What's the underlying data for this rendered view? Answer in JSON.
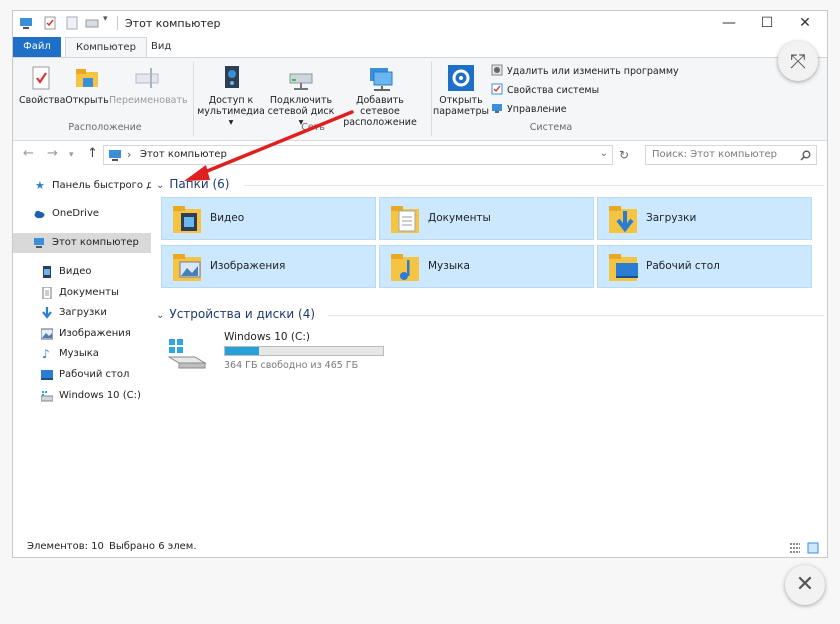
{
  "window": {
    "title": "Этот компьютер",
    "minimize_glyph": "—",
    "maximize_glyph": "☐",
    "close_glyph": "✕"
  },
  "ribbon_tabs": [
    {
      "label": "Файл"
    },
    {
      "label": "Компьютер"
    },
    {
      "label": "Вид"
    }
  ],
  "ribbon": {
    "groups": {
      "location": "Расположение",
      "network": "Сеть",
      "system": "Система"
    },
    "buttons": {
      "properties": "Свойства",
      "open": "Открыть",
      "rename": "Переименовать",
      "media_line1": "Доступ к",
      "media_line2": "мультимедиа ▾",
      "map_drive_line1": "Подключить",
      "map_drive_line2": "сетевой диск ▾",
      "add_location_line1": "Добавить сетевое",
      "add_location_line2": "расположение",
      "open_settings_line1": "Открыть",
      "open_settings_line2": "параметры",
      "uninstall": "Удалить или изменить программу",
      "system_props": "Свойства системы",
      "manage": "Управление"
    }
  },
  "address_bar": {
    "path": "Этот компьютер",
    "separator": "›",
    "search_placeholder": "Поиск: Этот компьютер"
  },
  "nav_pane": [
    {
      "label": "Панель быстрого дс",
      "icon": "star-icon"
    },
    {
      "label": "OneDrive",
      "icon": "cloud-icon"
    },
    {
      "label": "Этот компьютер",
      "icon": "computer-icon"
    },
    {
      "label": "Видео",
      "icon": "video-icon"
    },
    {
      "label": "Документы",
      "icon": "document-icon"
    },
    {
      "label": "Загрузки",
      "icon": "download-icon"
    },
    {
      "label": "Изображения",
      "icon": "pictures-icon"
    },
    {
      "label": "Музыка",
      "icon": "music-icon"
    },
    {
      "label": "Рабочий стол",
      "icon": "desktop-icon"
    },
    {
      "label": "Windows 10 (C:)",
      "icon": "drive-icon"
    }
  ],
  "folders": {
    "heading": "Папки (6)",
    "items": [
      {
        "label": "Видео"
      },
      {
        "label": "Документы"
      },
      {
        "label": "Загрузки"
      },
      {
        "label": "Изображения"
      },
      {
        "label": "Музыка"
      },
      {
        "label": "Рабочий стол"
      }
    ]
  },
  "devices": {
    "heading": "Устройства и диски (4)",
    "drive": {
      "name": "Windows 10 (C:)",
      "free_text": "364 ГБ свободно из 465 ГБ",
      "used_fraction": 0.217
    }
  },
  "status": {
    "items": "Элементов: 10",
    "selected": "Выбрано 6 элем."
  },
  "colors": {
    "accent": "#1e6fc7",
    "tile_bg": "#cce8ff",
    "arrow": "#e02020",
    "drive_bar": "#26a0da"
  }
}
